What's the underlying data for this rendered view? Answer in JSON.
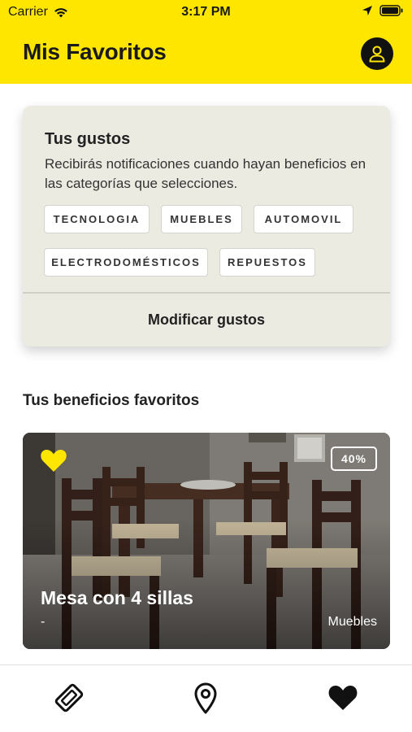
{
  "status_bar": {
    "carrier": "Carrier",
    "time": "3:17 PM",
    "icons": [
      "wifi-icon",
      "location-arrow-icon",
      "battery-icon"
    ]
  },
  "header": {
    "title": "Mis Favoritos",
    "profile_icon": "user-icon"
  },
  "preferences": {
    "title": "Tus gustos",
    "description": "Recibirás notificaciones cuando hayan beneficios en las categorías que selecciones.",
    "categories": [
      "TECNOLOGIA",
      "MUEBLES",
      "AUTOMOVIL",
      "ELECTRODOMÉSTICOS",
      "REPUESTOS"
    ],
    "modify_label": "Modificar gustos"
  },
  "favorites": {
    "section_title": "Tus beneficios favoritos",
    "items": [
      {
        "name": "Mesa con 4 sillas",
        "subtitle": "-",
        "category": "Muebles",
        "discount": "40%",
        "favorited": true,
        "image": "dining-table-with-4-chairs"
      }
    ]
  },
  "tab_bar": {
    "tabs": [
      {
        "icon": "coupon-ticket-icon"
      },
      {
        "icon": "map-pin-icon"
      },
      {
        "icon": "heart-icon",
        "active": true
      }
    ]
  },
  "colors": {
    "accent": "#ffe600",
    "card_bg": "#ecebe2",
    "favorite_heart": "#ffe600"
  }
}
